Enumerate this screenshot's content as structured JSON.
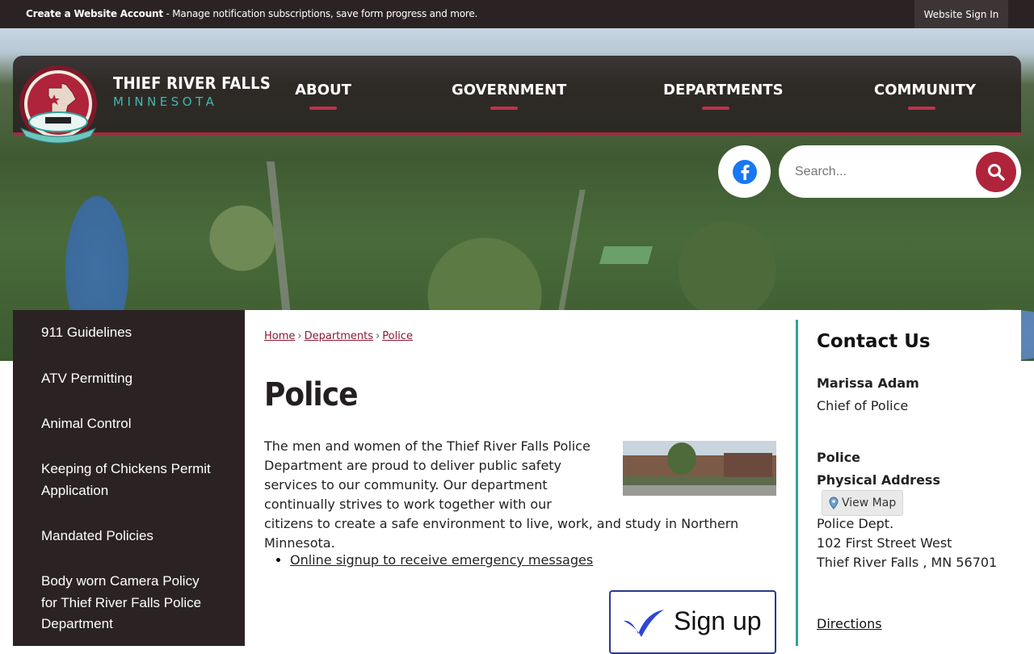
{
  "topbar": {
    "create_label": "Create a Website Account",
    "create_desc": " - Manage notification subscriptions, save form progress and more.",
    "signin_label": "Website Sign In"
  },
  "brand": {
    "name_line1": "THIEF RIVER FALLS",
    "name_line2": "MINNESOTA",
    "seal_top": "THIEF RIVER FALLS",
    "seal_inc": "Inc. 1896",
    "seal_bottom": "MINNESOTA"
  },
  "nav": {
    "items": [
      {
        "label": "ABOUT"
      },
      {
        "label": "GOVERNMENT"
      },
      {
        "label": "DEPARTMENTS"
      },
      {
        "label": "COMMUNITY"
      }
    ]
  },
  "search": {
    "placeholder": "Search..."
  },
  "sidebar": {
    "items": [
      {
        "label": "911 Guidelines"
      },
      {
        "label": "ATV Permitting"
      },
      {
        "label": "Animal Control"
      },
      {
        "label": "Keeping of Chickens Permit Application"
      },
      {
        "label": "Mandated Policies"
      },
      {
        "label": "Body worn Camera Policy for Thief River Falls Police Department"
      }
    ]
  },
  "breadcrumb": {
    "items": [
      "Home",
      "Departments",
      "Police"
    ],
    "separator": "›"
  },
  "page": {
    "title": "Police",
    "intro": "The men and women of the Thief River Falls Police Department are proud to deliver public safety services to our community. Our department continually strives to work together with our citizens to create a safe environment to live, work, and study in Northern Minnesota.",
    "links": [
      "Online signup to receive emergency messages"
    ],
    "signup_label": "Sign up"
  },
  "contact": {
    "title": "Contact Us",
    "person_name": "Marissa Adam",
    "person_title": "Chief of Police",
    "dept_name": "Police",
    "address_label": "Physical Address",
    "map_button": "View Map",
    "address_line1": "Police Dept.",
    "address_line2": "102 First Street West",
    "address_line3": "Thief River Falls , MN 56701",
    "directions_label": "Directions"
  },
  "colors": {
    "dark": "#2b2323",
    "accent": "#b0243b",
    "teal": "#2fa39a",
    "link": "#8a1a33"
  }
}
